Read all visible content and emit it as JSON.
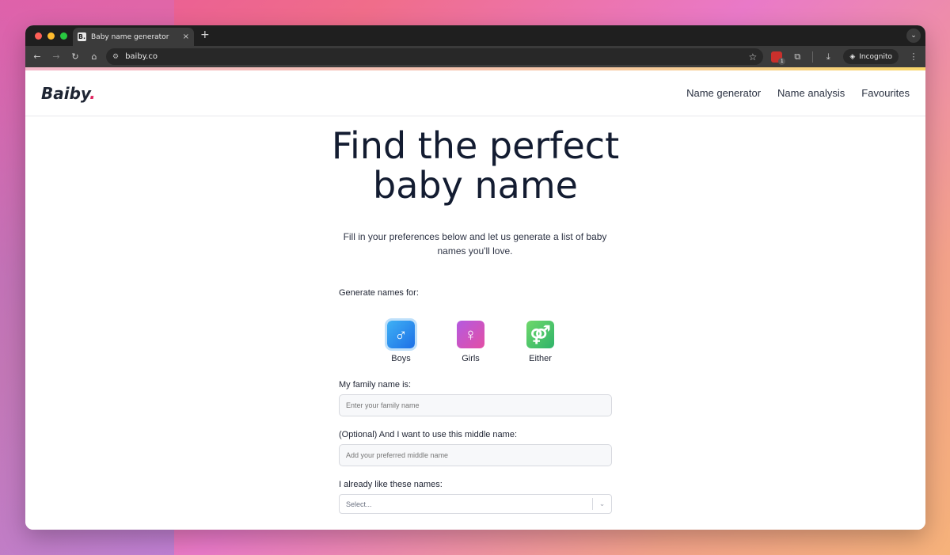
{
  "browser": {
    "tab_title": "Baby name generator",
    "tab_favicon": "B.",
    "tab_close": "×",
    "new_tab": "+",
    "url": "baiby.co",
    "incognito_label": "Incognito",
    "ext_badge": "1"
  },
  "site": {
    "logo": "Baiby",
    "logo_dot": ".",
    "nav": [
      "Name generator",
      "Name analysis",
      "Favourites"
    ]
  },
  "hero": {
    "title": "Find the perfect baby name",
    "subtitle": "Fill in your preferences below and let us generate a list of baby names you'll love."
  },
  "form": {
    "gender_prompt": "Generate names for:",
    "genders": [
      {
        "label": "Boys",
        "glyph": "♂",
        "selected": true
      },
      {
        "label": "Girls",
        "glyph": "♀",
        "selected": false
      },
      {
        "label": "Either",
        "glyph": "⚤",
        "selected": false
      }
    ],
    "family_label": "My family name is:",
    "family_placeholder": "Enter your family name",
    "middle_label": "(Optional) And I want to use this middle name:",
    "middle_placeholder": "Add your preferred middle name",
    "liked_label": "I already like these names:",
    "liked_placeholder": "Select..."
  },
  "colors": {
    "brand_dot": "#e0245e",
    "boys_start": "#3fb1f5",
    "girls_start": "#b45ae0",
    "either_start": "#6fd86b"
  }
}
